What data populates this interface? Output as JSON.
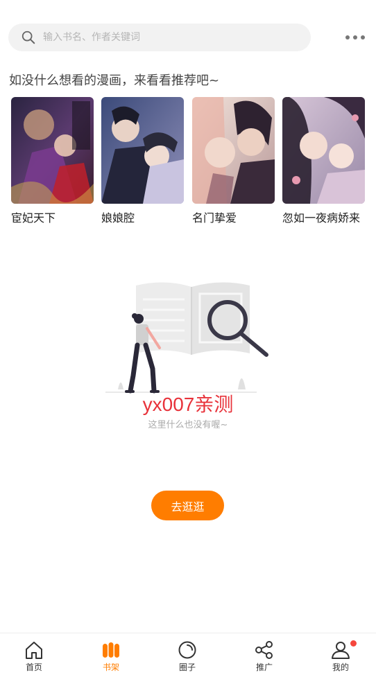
{
  "search": {
    "placeholder": "输入书名、作者关键词"
  },
  "recommend": {
    "title": "如没什么想看的漫画，来看看推荐吧~",
    "books": [
      {
        "title": "宦妃天下"
      },
      {
        "title": "娘娘腔"
      },
      {
        "title": "名门挚爱"
      },
      {
        "title": "忽如一夜病娇来"
      }
    ]
  },
  "empty": {
    "watermark": "yx007亲测",
    "message": "这里什么也没有喔~",
    "button_label": "去逛逛"
  },
  "tabbar": {
    "tabs": [
      {
        "label": "首页",
        "icon": "home-icon"
      },
      {
        "label": "书架",
        "icon": "bookshelf-icon",
        "active": true
      },
      {
        "label": "圈子",
        "icon": "circle-icon"
      },
      {
        "label": "推广",
        "icon": "share-icon"
      },
      {
        "label": "我的",
        "icon": "user-icon"
      }
    ]
  },
  "colors": {
    "accent": "#ff7d00",
    "badge": "#f5463c",
    "watermark": "#e8323a"
  }
}
